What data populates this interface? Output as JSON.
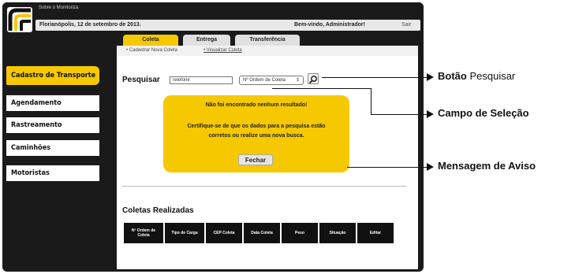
{
  "header": {
    "system_name": "Sobre o Monitoriza",
    "date": "Florianópolis, 12 de setembro de 2013.",
    "welcome": "Bem-vindo, Administrador!",
    "logout": "Sair"
  },
  "tabs": [
    {
      "label": "Coleta",
      "active": true
    },
    {
      "label": "Entrega",
      "active": false
    },
    {
      "label": "Transferência",
      "active": false
    }
  ],
  "subnav": {
    "item1": "• Cadastrar Nova Coleta",
    "item2": "• Visualizar Coleta"
  },
  "sidebar": {
    "items": [
      {
        "label": "Cadastro de Transporte",
        "active": true
      },
      {
        "label": "Agendamento",
        "active": false
      },
      {
        "label": "Rastreamento",
        "active": false
      },
      {
        "label": "Caminhões",
        "active": false
      },
      {
        "label": "Motoristas",
        "active": false
      }
    ]
  },
  "search": {
    "label": "Pesquisar",
    "input_value": "Telefone",
    "select_value": "Nº Ordem de Coleta",
    "button_icon": "magnifier-icon"
  },
  "alert": {
    "title": "Não foi encontrado nenhum resultado!",
    "message": "Certifique-se de que os dados para a pesquisa estão corretos ou realize uma nova busca.",
    "close_label": "Fechar"
  },
  "results": {
    "title": "Coletas Realizadas",
    "columns": [
      "Nº Ordem de Coleta",
      "Tipo de Carga",
      "CEP Coleta",
      "Data Coleta",
      "Peso",
      "Situação",
      "Editar"
    ]
  },
  "callouts": {
    "search_button": {
      "bold": "Botão",
      "rest": " Pesquisar"
    },
    "select_field": {
      "bold": "Campo de Seleção",
      "rest": ""
    },
    "warning": {
      "bold": "Mensagem de Aviso",
      "rest": ""
    }
  },
  "colors": {
    "accent": "#f5c800",
    "frame": "#1a1a1a"
  }
}
